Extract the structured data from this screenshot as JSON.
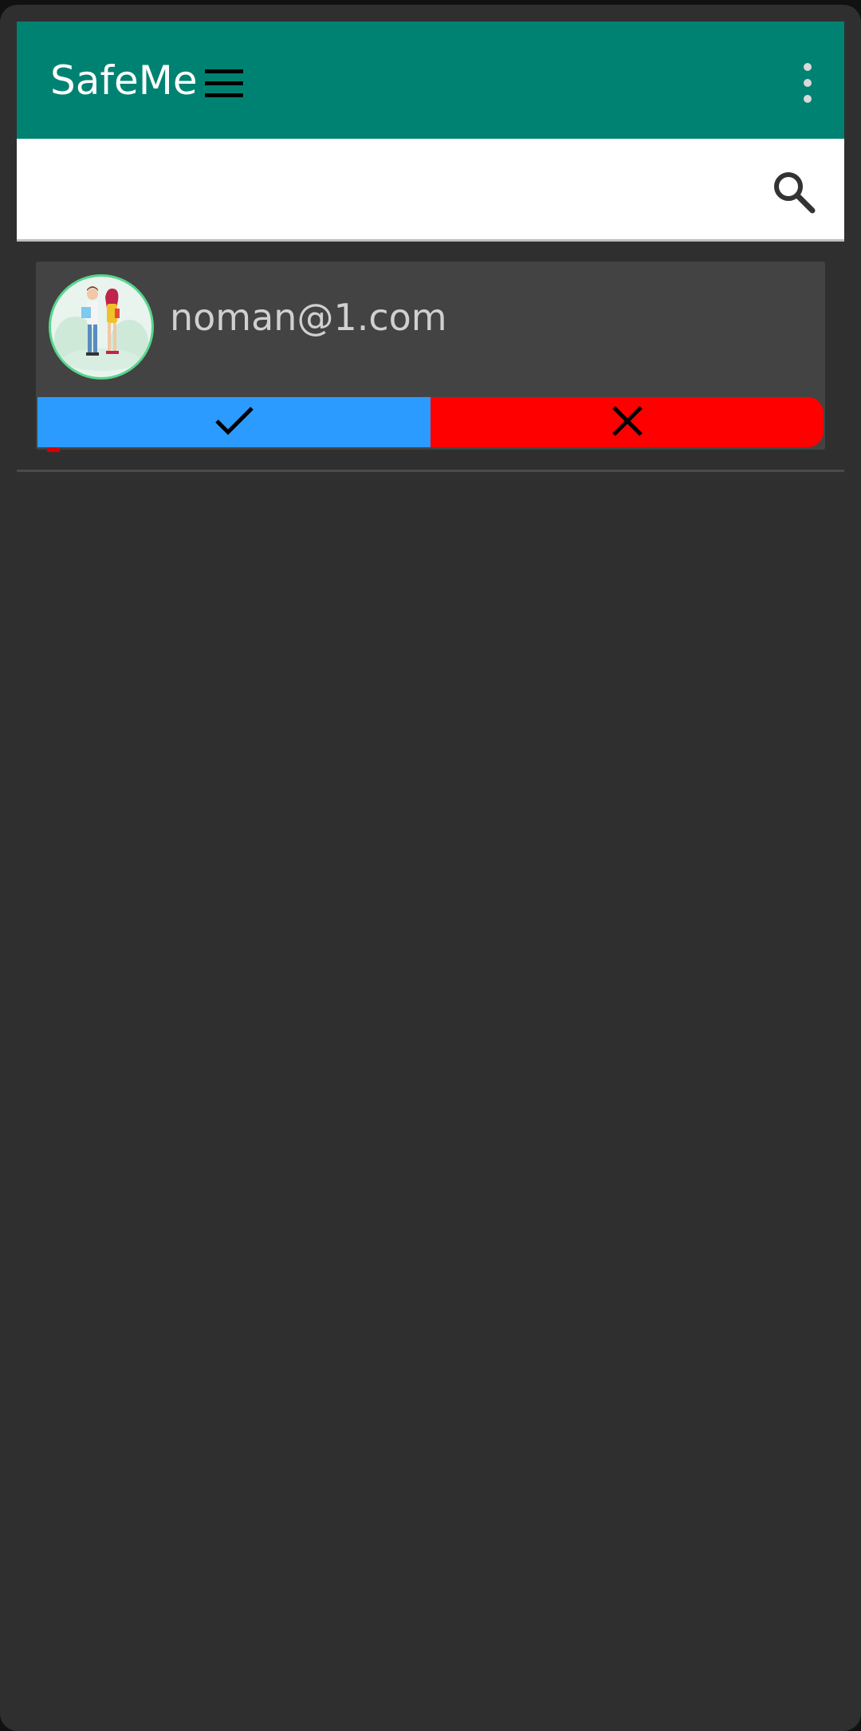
{
  "app": {
    "title": "SafeMe"
  },
  "theme": {
    "appbar_color": "#008272",
    "background_color": "#2f2f2f",
    "card_color": "#434343",
    "accept_color": "#2b9bff",
    "reject_color": "#ff0000"
  },
  "icons": {
    "menu": "hamburger-menu-icon",
    "overflow": "more-vertical-icon",
    "search": "search-icon",
    "accept": "checkmark-icon",
    "reject": "close-icon"
  },
  "search": {
    "value": "",
    "placeholder": ""
  },
  "requests": [
    {
      "email": "noman@1.com"
    }
  ]
}
